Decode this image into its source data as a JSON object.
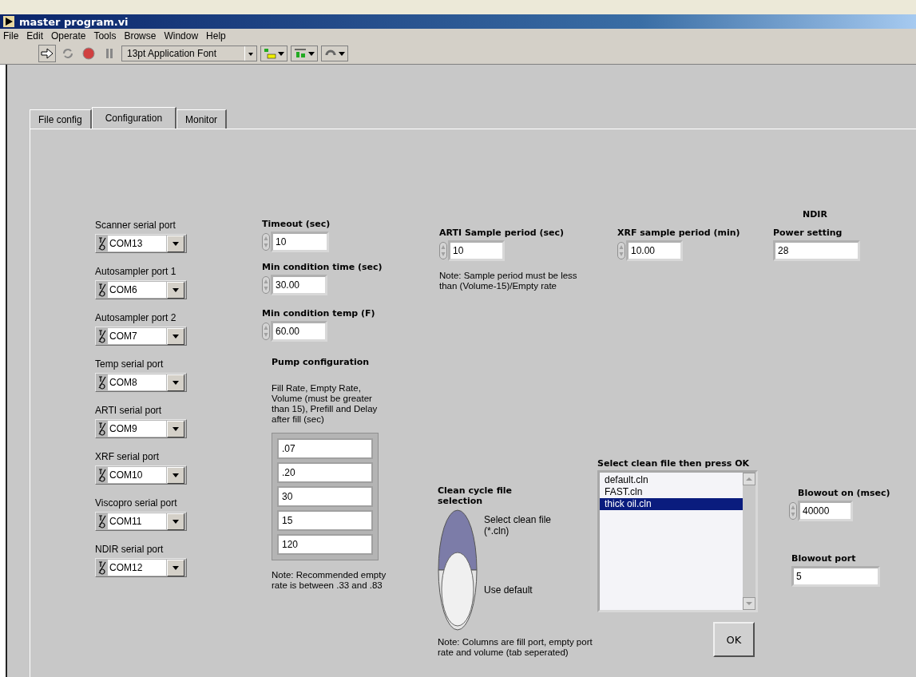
{
  "window": {
    "title": "master program.vi"
  },
  "menu": [
    "File",
    "Edit",
    "Operate",
    "Tools",
    "Browse",
    "Window",
    "Help"
  ],
  "toolbar": {
    "font": "13pt Application Font"
  },
  "tabs": [
    {
      "label": "File config",
      "selected": false
    },
    {
      "label": "Configuration",
      "selected": true
    },
    {
      "label": "Monitor",
      "selected": false
    }
  ],
  "serial_ports": [
    {
      "label": "Scanner serial port",
      "value": "COM13"
    },
    {
      "label": "Autosampler port 1",
      "value": "COM6"
    },
    {
      "label": "Autosampler port 2",
      "value": "COM7"
    },
    {
      "label": "Temp serial port",
      "value": "COM8"
    },
    {
      "label": "ARTI serial port",
      "value": "COM9"
    },
    {
      "label": "XRF serial port",
      "value": "COM10"
    },
    {
      "label": "Viscopro serial port",
      "value": "COM11"
    },
    {
      "label": "NDIR serial port",
      "value": "COM12"
    }
  ],
  "timeout": {
    "label": "Timeout (sec)",
    "value": "10"
  },
  "min_condition_time": {
    "label": "Min condition time (sec)",
    "value": "30.00"
  },
  "min_condition_temp": {
    "label": "Min condition temp (F)",
    "value": "60.00"
  },
  "pump": {
    "title": "Pump configuration",
    "description": "Fill Rate, Empty Rate, Volume (must be greater than 15), Prefill and Delay after fill (sec)",
    "values": [
      ".07",
      ".20",
      "30",
      "15",
      "120"
    ],
    "note": "Note:  Recommended empty rate is between .33 and .83"
  },
  "arti_sample_period": {
    "label": "ARTI Sample period (sec)",
    "value": "10",
    "note": "Note:  Sample period must be less than (Volume-15)/Empty rate"
  },
  "xrf_sample_period": {
    "label": "XRF sample period (min)",
    "value": "10.00"
  },
  "ndir": {
    "heading": "NDIR",
    "label": "Power setting",
    "value": "28"
  },
  "clean_cycle": {
    "title": "Clean cycle file selection",
    "options": [
      {
        "label": "Select clean file (*.cln)",
        "selected": false
      },
      {
        "label": "Use default",
        "selected": true
      }
    ],
    "note": "Note: Columns are fill port, empty port rate and volume (tab seperated)"
  },
  "clean_files": {
    "title": "Select clean file then press OK",
    "items": [
      {
        "label": "default.cln",
        "selected": false
      },
      {
        "label": "FAST.cln",
        "selected": false
      },
      {
        "label": "thick oil.cln",
        "selected": true
      }
    ],
    "button": "OK"
  },
  "blowout_on": {
    "label": "Blowout on (msec)",
    "value": "40000"
  },
  "blowout_port": {
    "label": "Blowout port",
    "value": "5"
  }
}
